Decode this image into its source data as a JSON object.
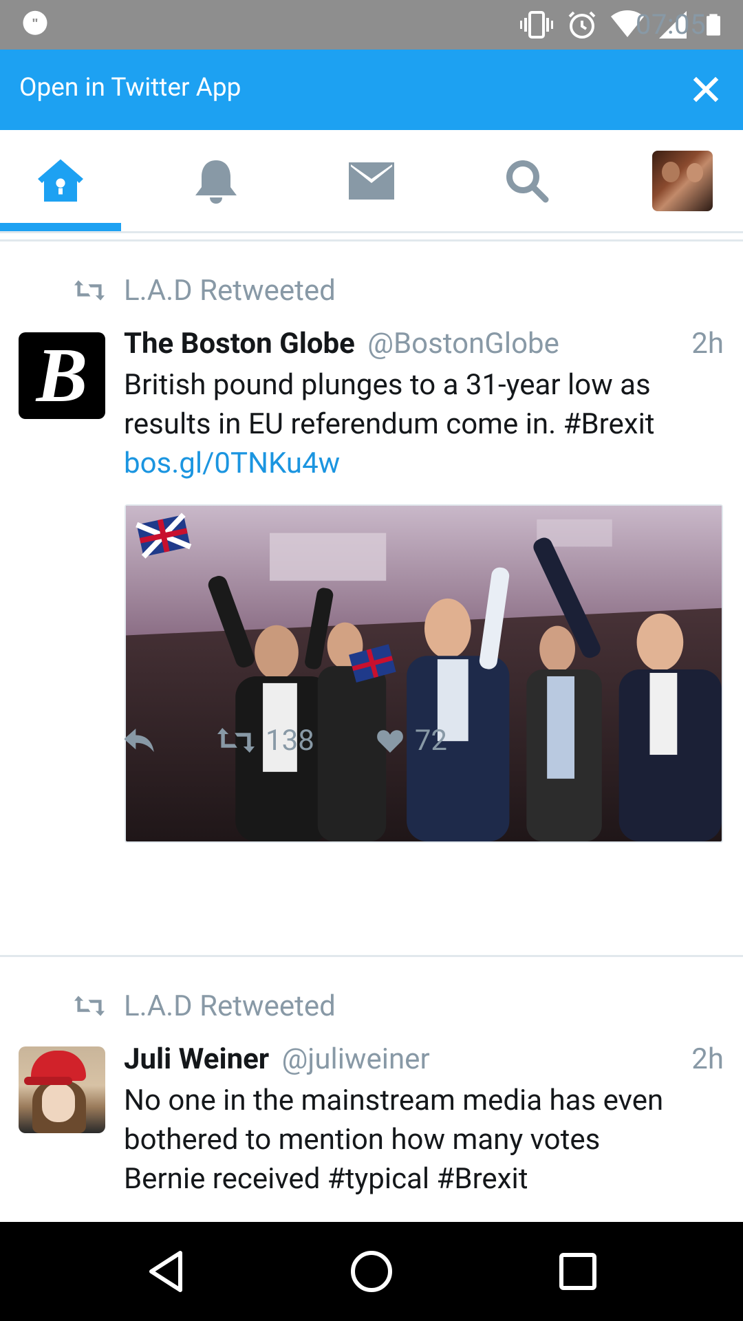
{
  "status_bar": {
    "time": "07:05",
    "left_icon": "hangouts-icon",
    "right_icons": [
      "vibrate-icon",
      "alarm-icon",
      "wifi-icon",
      "signal-icon",
      "battery-icon"
    ]
  },
  "banner": {
    "label": "Open in Twitter App",
    "close_icon": "close-icon"
  },
  "tabs": [
    {
      "name": "home",
      "icon": "home-icon",
      "active": true
    },
    {
      "name": "notifications",
      "icon": "bell-icon",
      "active": false
    },
    {
      "name": "messages",
      "icon": "envelope-icon",
      "active": false
    },
    {
      "name": "search",
      "icon": "search-icon",
      "active": false
    },
    {
      "name": "profile",
      "icon": "profile-avatar",
      "active": false
    }
  ],
  "tweets": [
    {
      "retweeted_by": "L.A.D Retweeted",
      "avatar_letter": "B",
      "name": "The Boston Globe",
      "handle": "@BostonGlobe",
      "time": "2h",
      "text_line1": "British pound plunges to a 31-year low as",
      "text_line2": "results in EU referendum come in. #Brexit",
      "link": "bos.gl/0TNKu4w",
      "retweets": "138",
      "likes": "72"
    },
    {
      "retweeted_by": "L.A.D Retweeted",
      "name": "Juli Weiner",
      "handle": "@juliweiner",
      "time": "2h",
      "text_line1": "No one in the mainstream media has even",
      "text_line2": "bothered to mention how many votes",
      "text_line3": "Bernie received #typical #Brexit"
    }
  ],
  "colors": {
    "accent": "#1da1f2",
    "link": "#1b95e0",
    "muted": "#8899a6",
    "status_bar": "#8e8e8e",
    "nav_bar": "#000000"
  },
  "nav_bar": [
    "back-icon",
    "home-circle-icon",
    "recents-icon"
  ]
}
